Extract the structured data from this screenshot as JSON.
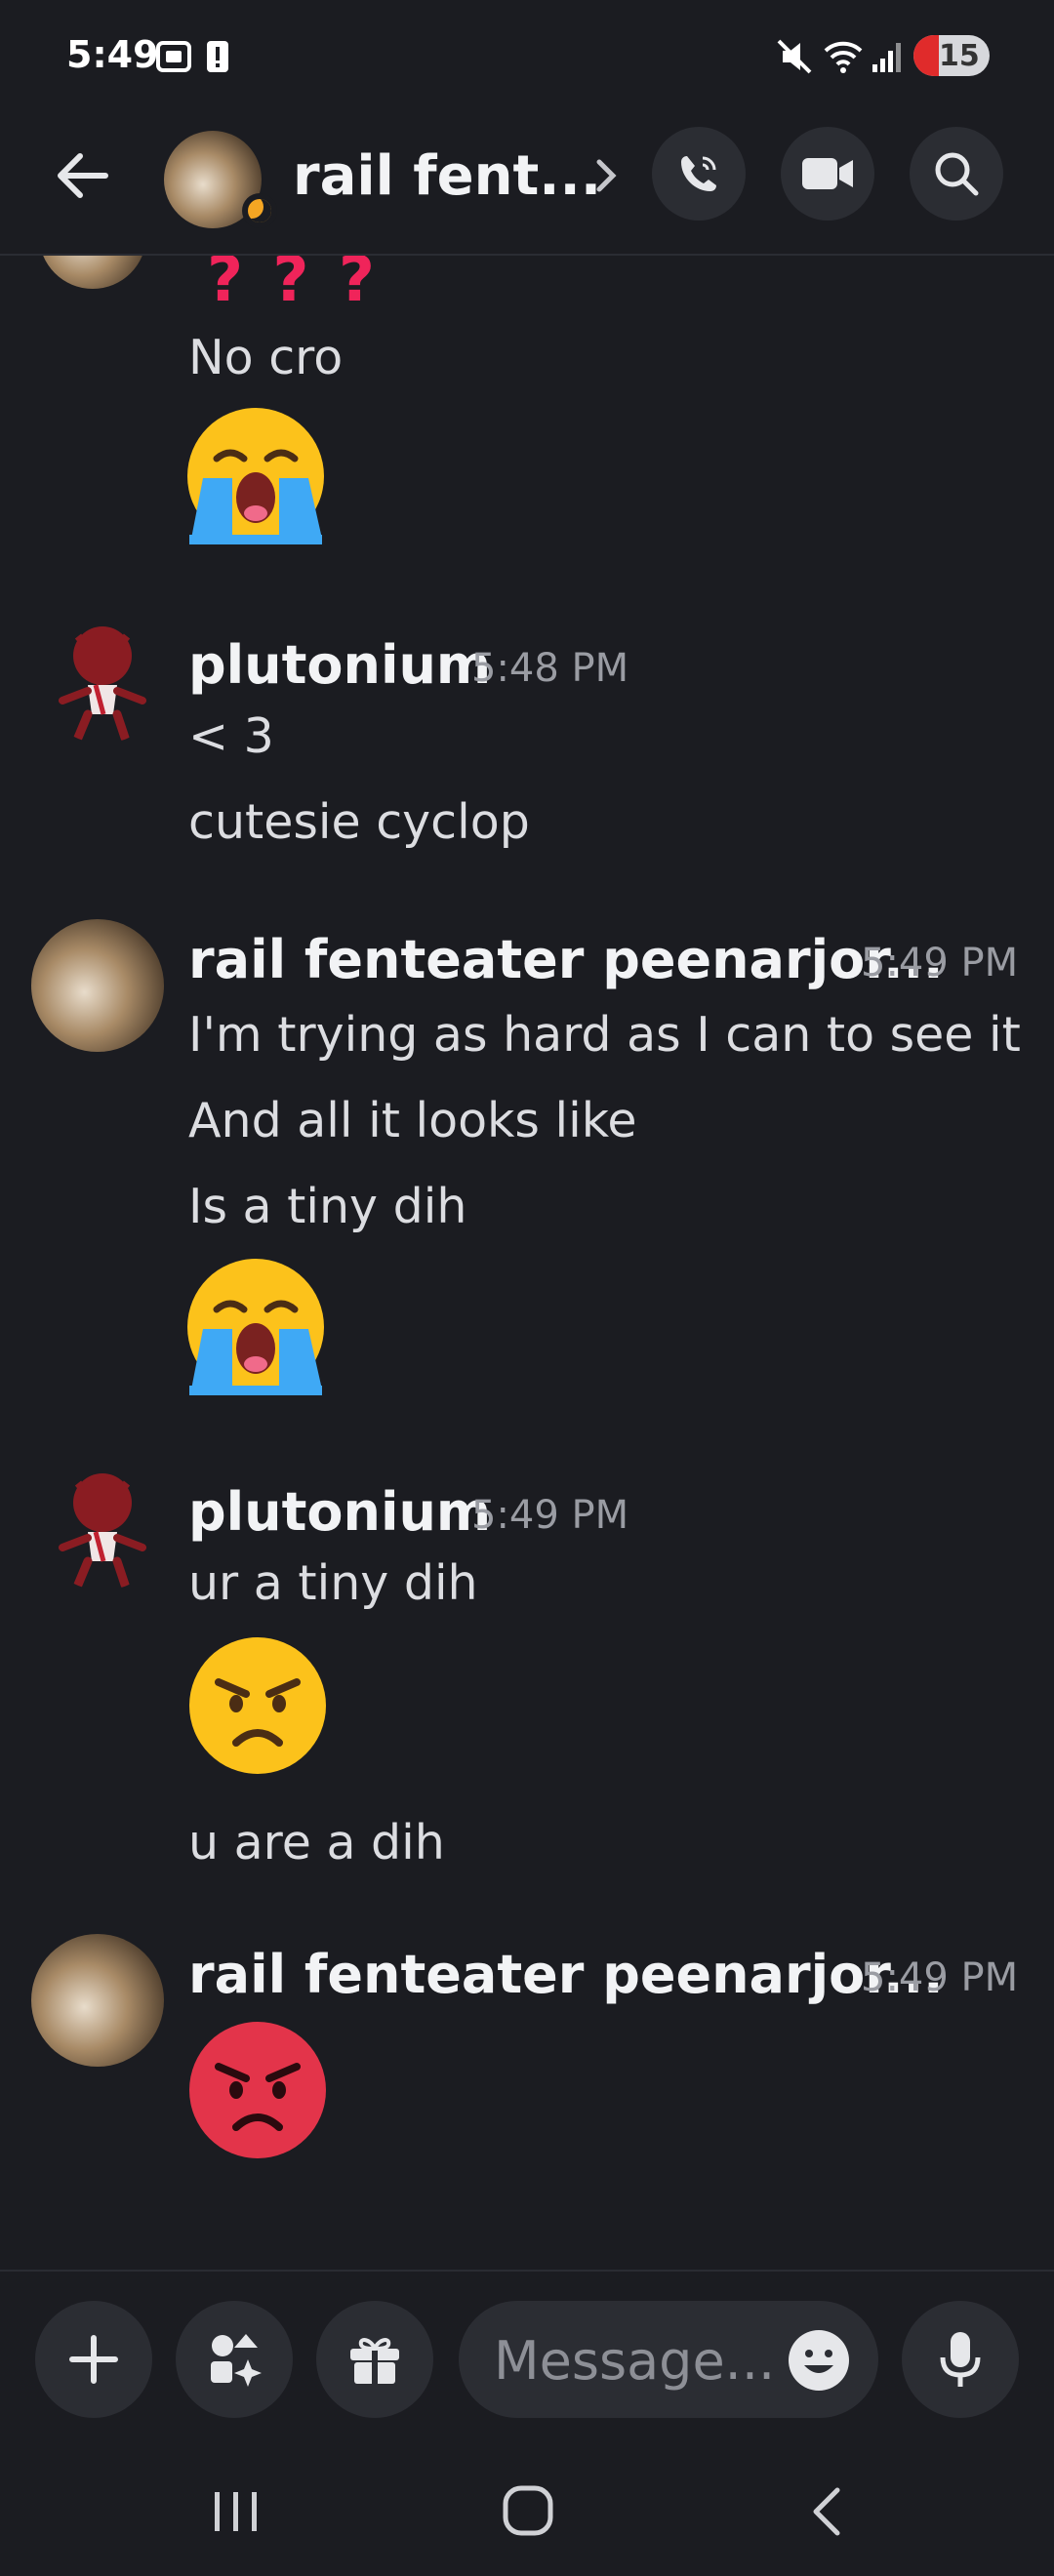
{
  "status_bar": {
    "time": "5:49",
    "battery": "15"
  },
  "header": {
    "title": "rail fent...",
    "icons": [
      "back-arrow-icon",
      "chevron-right-icon",
      "phone-call-icon",
      "video-camera-icon",
      "search-icon"
    ]
  },
  "messages": [
    {
      "lines": [
        "? ? ?",
        "No cro"
      ],
      "emoji": "loudly-crying-face"
    },
    {
      "username": "plutonium",
      "time": "5:48 PM",
      "lines": [
        "< 3",
        "cutesie cyclop"
      ]
    },
    {
      "username": "rail fenteater peenarjor...",
      "time": "5:49 PM",
      "lines": [
        "I'm trying as hard as I can to see it",
        "And all it looks like",
        "Is a tiny dih"
      ],
      "emoji": "loudly-crying-face"
    },
    {
      "username": "plutonium",
      "time": "5:49 PM",
      "lines": [
        "ur a tiny dih",
        "u are a dih"
      ],
      "emoji": "angry-face"
    },
    {
      "username": "rail fenteater peenarjor...",
      "time": "5:49 PM",
      "emoji": "pouting-face"
    }
  ],
  "composer": {
    "placeholder": "Message...",
    "icons": [
      "plus-icon",
      "apps-icon",
      "gift-icon",
      "emoji-icon",
      "microphone-icon"
    ]
  },
  "colors": {
    "background": "#1b1c21",
    "button_bg": "#2b2d33",
    "text": "#dcdde1",
    "timestamp": "#9a9ca3",
    "question_marks": "#f0245a"
  }
}
